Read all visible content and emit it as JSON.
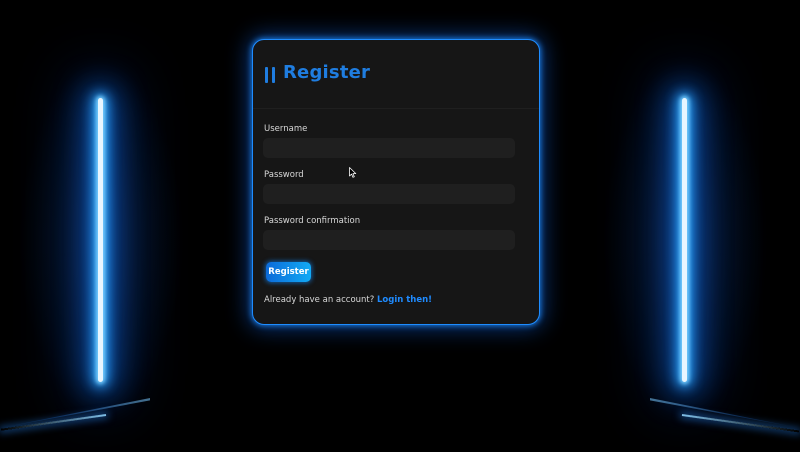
{
  "form": {
    "title": "Register",
    "title_icon": "double-bar-icon",
    "fields": [
      {
        "label": "Username",
        "value": "",
        "placeholder": ""
      },
      {
        "label": "Password",
        "value": "",
        "placeholder": ""
      },
      {
        "label": "Password confirmation",
        "value": "",
        "placeholder": ""
      }
    ],
    "submit_label": "Register",
    "login_prompt": "Already have an account?",
    "login_link": "Login then!"
  },
  "colors": {
    "accent": "#1f7de0",
    "neon": "#2aa4ff",
    "card_bg": "#161616",
    "input_bg": "#1f1f1f",
    "page_bg": "#000000"
  },
  "decorations": {
    "left_light": "neon-tube",
    "right_light": "neon-tube",
    "pointer": "arrow-cursor-icon"
  }
}
